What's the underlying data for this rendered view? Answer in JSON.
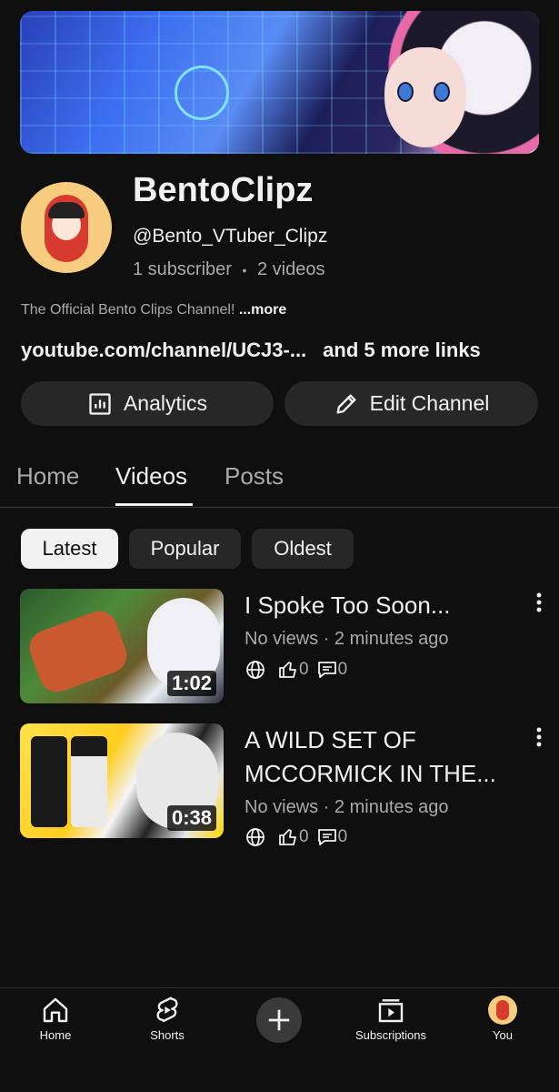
{
  "channel": {
    "name": "BentoClipz",
    "handle": "@Bento_VTuber_Clipz",
    "subscribers": "1 subscriber",
    "separator": "•",
    "video_count": "2 videos",
    "description": "The Official Bento Clips Channel!",
    "more_label": "...more",
    "link": "youtube.com/channel/UCJ3-...",
    "more_links": "and 5 more links"
  },
  "actions": {
    "analytics": "Analytics",
    "edit_channel": "Edit Channel"
  },
  "tabs": [
    {
      "label": "Home",
      "active": false
    },
    {
      "label": "Videos",
      "active": true
    },
    {
      "label": "Posts",
      "active": false
    }
  ],
  "filters": [
    {
      "label": "Latest",
      "selected": true
    },
    {
      "label": "Popular",
      "selected": false
    },
    {
      "label": "Oldest",
      "selected": false
    }
  ],
  "videos": [
    {
      "title": "I Spoke Too Soon...",
      "meta": "No views · 2 minutes ago",
      "duration": "1:02",
      "likes": "0",
      "comments": "0"
    },
    {
      "title": "A WILD SET OF MCCORMICK IN THE...",
      "meta": "No views · 2 minutes ago",
      "duration": "0:38",
      "likes": "0",
      "comments": "0"
    }
  ],
  "nav": {
    "home": "Home",
    "shorts": "Shorts",
    "subscriptions": "Subscriptions",
    "you": "You"
  },
  "colors": {
    "background": "#0f0f0f",
    "surface": "#272727",
    "text": "#f1f1f1",
    "muted": "#aaaaaa"
  }
}
